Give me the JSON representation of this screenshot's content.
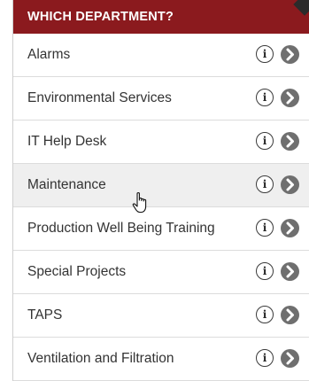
{
  "header": {
    "title": "WHICH DEPARTMENT?"
  },
  "departments": [
    {
      "label": "Alarms",
      "info_icon": "info-icon",
      "go_icon": "chevron-right-icon"
    },
    {
      "label": "Environmental Services",
      "info_icon": "info-icon",
      "go_icon": "chevron-right-icon"
    },
    {
      "label": "IT Help Desk",
      "info_icon": "info-icon",
      "go_icon": "chevron-right-icon"
    },
    {
      "label": "Maintenance",
      "info_icon": "info-icon",
      "go_icon": "chevron-right-icon",
      "hovered": true
    },
    {
      "label": "Production Well Being Training",
      "info_icon": "info-icon",
      "go_icon": "chevron-right-icon"
    },
    {
      "label": "Special Projects",
      "info_icon": "info-icon",
      "go_icon": "chevron-right-icon"
    },
    {
      "label": "TAPS",
      "info_icon": "info-icon",
      "go_icon": "chevron-right-icon"
    },
    {
      "label": "Ventilation and Filtration",
      "info_icon": "info-icon",
      "go_icon": "chevron-right-icon"
    }
  ],
  "info_glyph": "i",
  "colors": {
    "header_bg": "#8b1a1e",
    "header_text": "#ffffff",
    "hover_row_bg": "#efefef",
    "go_button": "#6f6f6f"
  }
}
